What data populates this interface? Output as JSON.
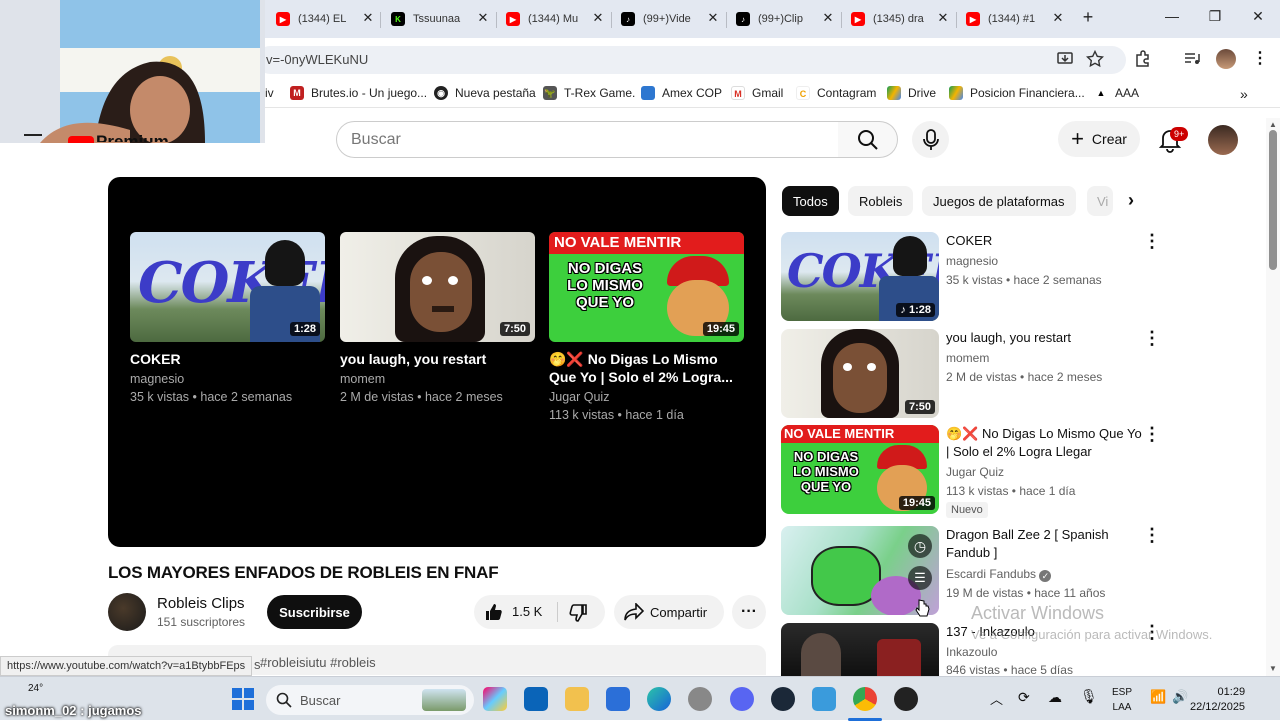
{
  "browser": {
    "tabs": [
      {
        "label": "(1344) EL",
        "icon": "youtube-icon",
        "color": "#ff0000"
      },
      {
        "label": "Tssuunaa",
        "icon": "kick-icon",
        "color": "#53fc18"
      },
      {
        "label": "(1344) Mu",
        "icon": "youtube-icon",
        "color": "#ff0000"
      },
      {
        "label": "(99+)Vide",
        "icon": "tiktok-icon",
        "color": "#000000"
      },
      {
        "label": "(99+)Clip",
        "icon": "tiktok-icon",
        "color": "#000000"
      },
      {
        "label": "(1345) dra",
        "icon": "youtube-icon",
        "color": "#ff0000"
      },
      {
        "label": "(1344) #1",
        "icon": "youtube-icon",
        "color": "#ff0000"
      }
    ],
    "new_tab": "+",
    "url": "v=-0nyWLEKuNU",
    "bookmarks": [
      {
        "label": "iv",
        "icon": ""
      },
      {
        "label": "Brutes.io - Un juego...",
        "icon": "brutes-icon"
      },
      {
        "label": "Nueva pestaña",
        "icon": "globe-icon"
      },
      {
        "label": "T-Rex Game.",
        "icon": "dino-icon"
      },
      {
        "label": "Amex COP",
        "icon": "amex-icon"
      },
      {
        "label": "Gmail",
        "icon": "gmail-icon"
      },
      {
        "label": "Contagram",
        "icon": "contagram-icon"
      },
      {
        "label": "Drive",
        "icon": "drive-icon"
      },
      {
        "label": "Posicion Financiera...",
        "icon": "drive-icon"
      },
      {
        "label": "AAA",
        "icon": "aaa-icon"
      }
    ],
    "status_url": "https://www.youtube.com/watch?v=a1BtybbFEps"
  },
  "youtube": {
    "logo_text": "Premium",
    "search_placeholder": "Buscar",
    "create_label": "Crear",
    "notif_badge": "9+",
    "player": {
      "end_screen": [
        {
          "title": "COKER",
          "channel": "magnesio",
          "meta": "35 k vistas • hace 2 semanas",
          "duration": "1:28",
          "thumb_text": "COKER"
        },
        {
          "title": "you laugh, you restart",
          "channel": "momem",
          "meta": "2 M de vistas • hace 2 meses",
          "duration": "7:50"
        },
        {
          "title": "🤭❌ No Digas Lo Mismo Que Yo | Solo el 2% Logra...",
          "channel": "Jugar Quiz",
          "meta": "113 k vistas • hace 1 día",
          "duration": "19:45",
          "thumb_lines": [
            "NO VALE MENTIR",
            "NO DIGAS",
            "LO MISMO",
            "QUE YO"
          ]
        }
      ]
    },
    "video": {
      "title": "LOS MAYORES ENFADOS DE ROBLEIS EN FNAF",
      "channel": "Robleis Clips",
      "subscribers": "151 suscriptores",
      "subscribe_label": "Suscribirse",
      "likes": "1.5 K",
      "share_label": "Compartir",
      "description_tags": "#robleisiutu #robleis",
      "description_prefix": "s"
    },
    "chips": [
      "Todos",
      "Robleis",
      "Juegos de plataformas",
      "Vi"
    ],
    "recommendations": [
      {
        "title": "COKER",
        "channel": "magnesio",
        "meta": "35 k vistas • hace 2 semanas",
        "duration": "1:28",
        "verified": false
      },
      {
        "title": "you laugh, you restart",
        "channel": "momem",
        "meta": "2 M de vistas • hace 2 meses",
        "duration": "7:50",
        "verified": false
      },
      {
        "title": "🤭❌ No Digas Lo Mismo Que Yo | Solo el 2% Logra Llegar",
        "channel": "Jugar Quiz",
        "meta": "113 k vistas • hace 1 día",
        "duration": "19:45",
        "badge": "Nuevo",
        "verified": false
      },
      {
        "title": "Dragon Ball Zee 2 [ Spanish Fandub ]",
        "channel": "Escardi Fandubs",
        "meta": "19 M de vistas • hace 11 años",
        "duration": "",
        "verified": true
      },
      {
        "title": "137 - Inkazoulo",
        "channel": "Inkazoulo",
        "meta": "846 vistas • hace 5 días",
        "duration": "",
        "verified": false
      }
    ]
  },
  "watermark": {
    "line1": "Activar Windows",
    "line2": "Ve a Configuración para activar Windows."
  },
  "taskbar": {
    "weather": "24°",
    "search_label": "Buscar",
    "lang": [
      "ESP",
      "LAA"
    ],
    "time": "01:29",
    "date": "22/12/2025"
  },
  "stream_chat": "simonm_02 : jugamos"
}
